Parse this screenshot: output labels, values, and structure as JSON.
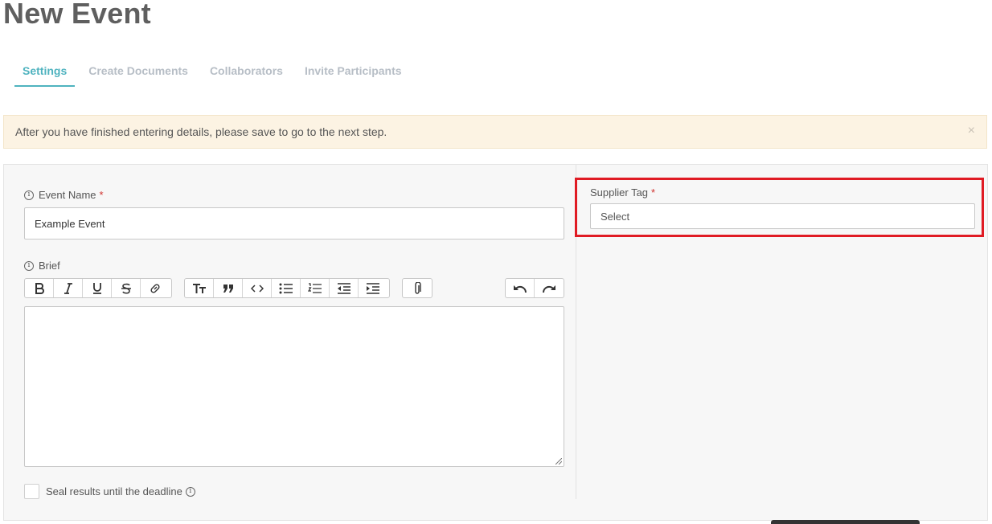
{
  "page": {
    "title": "New Event"
  },
  "tabs": [
    {
      "label": "Settings",
      "active": true
    },
    {
      "label": "Create Documents",
      "active": false
    },
    {
      "label": "Collaborators",
      "active": false
    },
    {
      "label": "Invite Participants",
      "active": false
    }
  ],
  "alert": {
    "message": "After you have finished entering details, please save to go to the next step.",
    "close_glyph": "×"
  },
  "form": {
    "event_name": {
      "label": "Event Name",
      "required_mark": "*",
      "value": "Example Event"
    },
    "brief": {
      "label": "Brief",
      "toolbar": [
        [
          "bold-icon",
          "italic-icon",
          "underline-icon",
          "strikethrough-icon",
          "link-icon"
        ],
        [
          "heading-icon",
          "quote-icon",
          "code-icon",
          "bullet-list-icon",
          "numbered-list-icon",
          "outdent-icon",
          "indent-icon"
        ],
        [
          "attach-icon"
        ],
        [
          "undo-icon",
          "redo-icon"
        ]
      ],
      "value": ""
    },
    "seal_results": {
      "label": "Seal results until the deadline",
      "checked": false
    },
    "supplier_tag": {
      "label": "Supplier Tag",
      "required_mark": "*",
      "placeholder": "Select"
    }
  },
  "colors": {
    "accent": "#4fb3bf",
    "required": "#d0312d",
    "highlight": "#e01b24",
    "alert_bg": "#fcf3e3"
  }
}
